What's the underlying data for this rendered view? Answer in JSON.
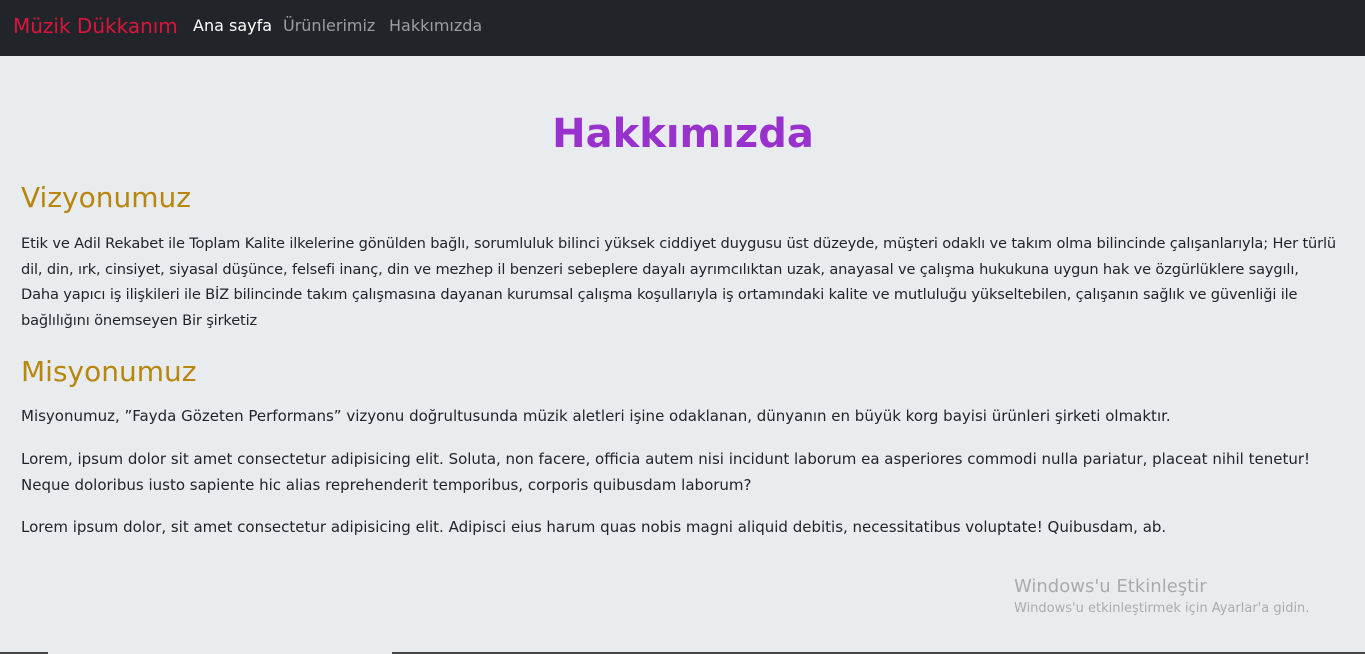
{
  "navbar": {
    "brand": "Müzik Dükkanım",
    "links": [
      {
        "label": "Ana sayfa",
        "active": true
      },
      {
        "label": "Ürünlerimiz",
        "active": false
      },
      {
        "label": "Hakkımızda",
        "active": false
      }
    ]
  },
  "main": {
    "title": "Hakkımızda",
    "vision": {
      "heading": "Vizyonumuz",
      "text": "Etik ve Adil Rekabet ile Toplam Kalite ilkelerine gönülden bağlı, sorumluluk bilinci yüksek ciddiyet duygusu üst düzeyde, müşteri odaklı ve takım olma bilincinde çalışanlarıyla; Her türlü dil, din, ırk, cinsiyet, siyasal düşünce, felsefi inanç, din ve mezhep il benzeri sebeplere dayalı ayrımcılıktan uzak, anayasal ve çalışma hukukuna uygun hak ve özgürlüklere saygılı, Daha yapıcı iş ilişkileri ile BİZ bilincinde takım çalışmasına dayanan kurumsal çalışma koşullarıyla iş ortamındaki kalite ve mutluluğu yükseltebilen, çalışanın sağlık ve güvenliği ile bağlılığını önemseyen Bir şirketiz"
    },
    "mission": {
      "heading": "Misyonumuz",
      "paragraphs": [
        "Misyonumuz, ”Fayda Gözeten Performans” vizyonu doğrultusunda müzik aletleri işine odaklanan, dünyanın en büyük korg bayisi ürünleri şirketi olmaktır.",
        "Lorem, ipsum dolor sit amet consectetur adipisicing elit. Soluta, non facere, officia autem nisi incidunt laborum ea asperiores commodi nulla pariatur, placeat nihil tenetur! Neque doloribus iusto sapiente hic alias reprehenderit temporibus, corporis quibusdam laborum?",
        "Lorem ipsum dolor, sit amet consectetur adipisicing elit. Adipisci eius harum quas nobis magni aliquid debitis, necessitatibus voluptate! Quibusdam, ab."
      ]
    }
  },
  "watermark": {
    "title": "Windows'u Etkinleştir",
    "subtitle": "Windows'u etkinleştirmek için Ayarlar'a gidin."
  },
  "colors": {
    "navbar_bg": "#212529",
    "brand": "#dc143c",
    "title": "#9932cc",
    "heading": "#b8860b",
    "page_bg": "#e9ecef"
  }
}
